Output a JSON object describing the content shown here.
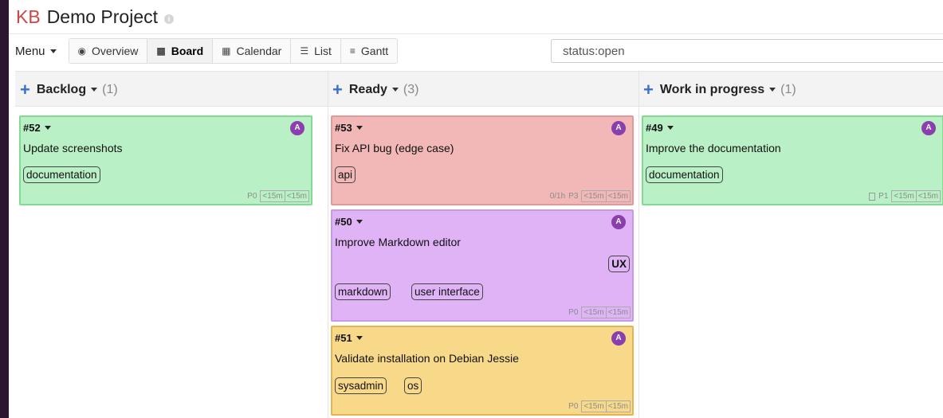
{
  "header": {
    "logo": "KB",
    "title": "Demo Project",
    "info_glyph": "i"
  },
  "toolbar": {
    "menu_label": "Menu",
    "views": [
      {
        "label": "Overview",
        "icon": "eye-icon",
        "glyph": "◉"
      },
      {
        "label": "Board",
        "icon": "board-icon",
        "glyph": "▦"
      },
      {
        "label": "Calendar",
        "icon": "calendar-icon",
        "glyph": "▦"
      },
      {
        "label": "List",
        "icon": "list-icon",
        "glyph": "☰"
      },
      {
        "label": "Gantt",
        "icon": "gantt-icon",
        "glyph": "≡"
      }
    ],
    "active_view": "Board",
    "search_value": "status:open"
  },
  "columns": [
    {
      "title": "Backlog",
      "count": "(1)",
      "cards": [
        {
          "id": "#52",
          "assignee": "A",
          "title": "Update screenshots",
          "color": "#baf0c5",
          "tags": [
            "documentation"
          ],
          "meta": {
            "priority": "P0",
            "estimate": "<15m",
            "spent": "<15m"
          }
        }
      ]
    },
    {
      "title": "Ready",
      "count": "(3)",
      "cards": [
        {
          "id": "#53",
          "assignee": "A",
          "title": "Fix API bug (edge case)",
          "color": "#f2b7b7",
          "tags": [
            "api"
          ],
          "meta": {
            "subtasks": "0/1h",
            "priority": "P3",
            "estimate": "<15m",
            "spent": "<15m"
          }
        },
        {
          "id": "#50",
          "assignee": "A",
          "title": "Improve Markdown editor",
          "color": "#dfb3f6",
          "category": "UX",
          "tags": [
            "markdown",
            "user interface"
          ],
          "meta": {
            "priority": "P0",
            "estimate": "<15m",
            "spent": "<15m"
          }
        },
        {
          "id": "#51",
          "assignee": "A",
          "title": "Validate installation on Debian Jessie",
          "color": "#f8d98a",
          "tags": [
            "sysadmin",
            "os"
          ],
          "meta": {
            "priority": "P0",
            "estimate": "<15m",
            "spent": "<15m"
          }
        }
      ]
    },
    {
      "title": "Work in progress",
      "count": "(1)",
      "cards": [
        {
          "id": "#49",
          "assignee": "A",
          "title": "Improve the documentation",
          "color": "#baf0c5",
          "tags": [
            "documentation"
          ],
          "meta": {
            "priority": "P1",
            "estimate": "<15m",
            "spent": "<15m"
          }
        }
      ]
    }
  ]
}
